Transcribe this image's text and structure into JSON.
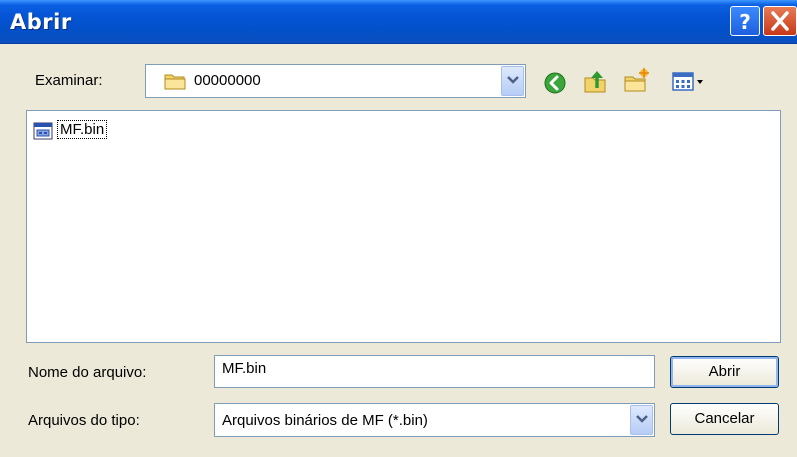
{
  "window": {
    "title": "Abrir",
    "controls": {
      "help_icon": "help-icon",
      "close_icon": "close-icon"
    }
  },
  "lookin": {
    "label": "Examinar:",
    "value": "00000000",
    "folder_icon": "folder-icon"
  },
  "toolbar": {
    "icons": [
      "back-icon",
      "up-folder-icon",
      "new-folder-icon",
      "view-menu-icon"
    ]
  },
  "files": [
    {
      "name": "MF.bin",
      "icon": "bin-file-icon"
    }
  ],
  "filename": {
    "label": "Nome do arquivo:",
    "value": "MF.bin"
  },
  "filetype": {
    "label": "Arquivos do tipo:",
    "value": "Arquivos binários de MF (*.bin)"
  },
  "buttons": {
    "open": "Abrir",
    "cancel": "Cancelar"
  },
  "colors": {
    "titlebar": "#0454d4",
    "dialog_bg": "#ece9d8",
    "field_border": "#7f9db9",
    "close_button": "#c8381a"
  }
}
